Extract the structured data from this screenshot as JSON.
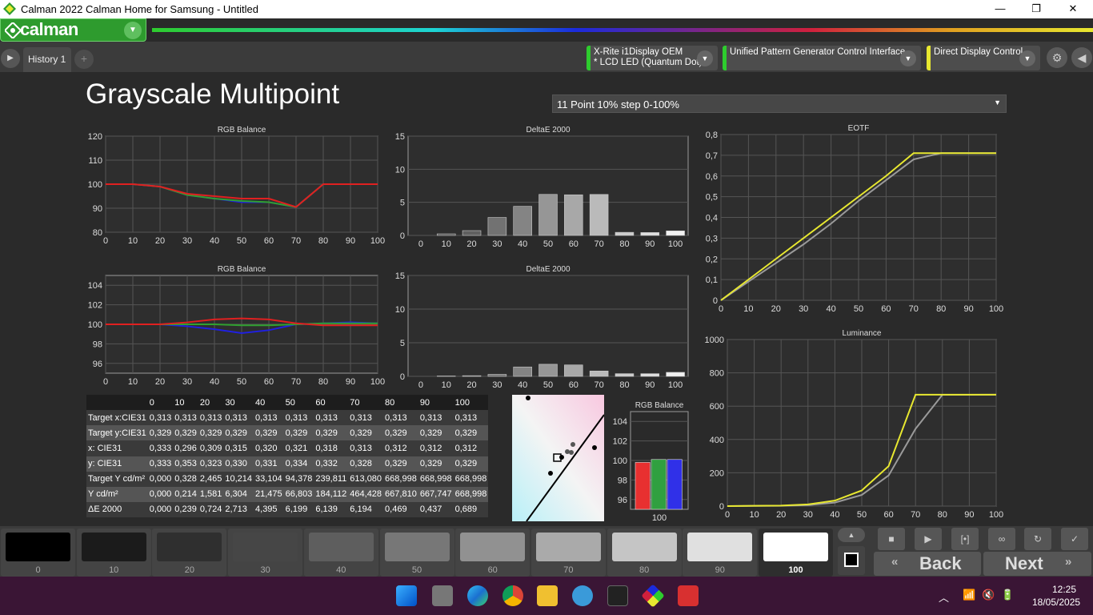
{
  "window": {
    "title": "Calman 2022 Calman Home for Samsung  - Untitled",
    "min": "—",
    "restore": "❐",
    "close": "✕"
  },
  "app": {
    "logo": "calman",
    "tab": "History 1",
    "tab_add": "+"
  },
  "devices": [
    {
      "line1": "X-Rite i1Display OEM",
      "line2": "* LCD LED (Quantum Dot)",
      "color": "#2ecc2e"
    },
    {
      "line1": "Unified Pattern Generator Control Interface",
      "line2": "",
      "color": "#2ecc2e"
    },
    {
      "line1": "Direct Display Control",
      "line2": "",
      "color": "#e8e830"
    }
  ],
  "page": {
    "title": "Grayscale Multipoint",
    "preset": "11 Point 10% step 0-100%"
  },
  "charts": {
    "rgb1": {
      "title": "RGB Balance"
    },
    "de1": {
      "title": "DeltaE 2000"
    },
    "rgb2": {
      "title": "RGB Balance"
    },
    "de2": {
      "title": "DeltaE 2000"
    },
    "eotf": {
      "title": "EOTF"
    },
    "lum": {
      "title": "Luminance"
    },
    "rgbbar": {
      "title": "RGB Balance"
    }
  },
  "chart_data": [
    {
      "type": "line",
      "title": "RGB Balance",
      "x": [
        0,
        10,
        20,
        30,
        40,
        50,
        60,
        70,
        80,
        90,
        100
      ],
      "ylim": [
        80,
        120
      ],
      "yticks": [
        80,
        90,
        100,
        110,
        120
      ],
      "series": [
        {
          "color": "#e02020",
          "values": [
            100,
            100,
            99,
            96,
            95,
            94,
            94,
            90.5,
            100,
            100,
            100
          ]
        },
        {
          "color": "#30a030",
          "values": [
            100,
            100,
            99,
            95.5,
            94,
            93,
            92.5,
            90.5,
            100,
            100,
            100
          ]
        },
        {
          "color": "#2020e0",
          "values": [
            100,
            100,
            99,
            95.5,
            94,
            92.5,
            92.5,
            90.5,
            100,
            100,
            100
          ]
        }
      ]
    },
    {
      "type": "bar",
      "title": "DeltaE 2000",
      "categories": [
        "0",
        "10",
        "20",
        "30",
        "40",
        "50",
        "60",
        "70",
        "80",
        "90",
        "100"
      ],
      "values": [
        0.0,
        0.239,
        0.724,
        2.713,
        4.395,
        6.199,
        6.139,
        6.194,
        0.469,
        0.437,
        0.689
      ],
      "ylim": [
        0,
        15
      ],
      "yticks": [
        0,
        5,
        10,
        15
      ]
    },
    {
      "type": "line",
      "title": "RGB Balance",
      "x": [
        0,
        10,
        20,
        30,
        40,
        50,
        60,
        70,
        80,
        90,
        100
      ],
      "ylim": [
        95,
        105
      ],
      "yticks": [
        96,
        98,
        100,
        102,
        104
      ],
      "series": [
        {
          "color": "#e02020",
          "values": [
            100,
            100,
            100,
            100.2,
            100.5,
            100.6,
            100.5,
            100.1,
            99.9,
            99.9,
            99.9
          ]
        },
        {
          "color": "#30a030",
          "values": [
            100,
            100,
            100,
            100,
            100,
            99.9,
            99.9,
            100,
            100.1,
            100.1,
            100.1
          ]
        },
        {
          "color": "#2020e0",
          "values": [
            100,
            100,
            100,
            99.8,
            99.5,
            99.1,
            99.4,
            100,
            100.1,
            100.2,
            100.1
          ]
        }
      ]
    },
    {
      "type": "bar",
      "title": "DeltaE 2000",
      "categories": [
        "0",
        "10",
        "20",
        "30",
        "40",
        "50",
        "60",
        "70",
        "80",
        "90",
        "100"
      ],
      "values": [
        0.0,
        0.05,
        0.1,
        0.3,
        1.4,
        1.8,
        1.7,
        0.8,
        0.4,
        0.4,
        0.6
      ],
      "ylim": [
        0,
        15
      ],
      "yticks": [
        0,
        5,
        10,
        15
      ]
    },
    {
      "type": "line",
      "title": "EOTF",
      "x": [
        0,
        10,
        20,
        30,
        40,
        50,
        60,
        70,
        80,
        90,
        100
      ],
      "ylim": [
        0,
        0.8
      ],
      "yticks": [
        "0",
        "0,1",
        "0,2",
        "0,3",
        "0,4",
        "0,5",
        "0,6",
        "0,7",
        "0,8"
      ],
      "series": [
        {
          "color": "#e8e830",
          "values": [
            0,
            0.1,
            0.2,
            0.3,
            0.4,
            0.5,
            0.6,
            0.71,
            0.71,
            0.71,
            0.71
          ]
        },
        {
          "color": "#9a9a9a",
          "values": [
            0,
            0.09,
            0.18,
            0.27,
            0.37,
            0.48,
            0.58,
            0.68,
            0.71,
            0.71,
            0.71
          ]
        }
      ]
    },
    {
      "type": "line",
      "title": "Luminance",
      "x": [
        0,
        10,
        20,
        30,
        40,
        50,
        60,
        70,
        80,
        90,
        100
      ],
      "ylim": [
        0,
        1000
      ],
      "yticks": [
        0,
        200,
        400,
        600,
        800,
        1000
      ],
      "series": [
        {
          "color": "#e8e830",
          "values": [
            0,
            2,
            3,
            10,
            33,
            94,
            240,
            669,
            669,
            669,
            669
          ]
        },
        {
          "color": "#9a9a9a",
          "values": [
            0,
            1,
            2,
            6,
            21,
            67,
            184,
            464,
            668,
            668,
            669
          ]
        }
      ]
    },
    {
      "type": "bar",
      "title": "RGB Balance",
      "categories": [
        "100"
      ],
      "ylim": [
        95,
        105
      ],
      "yticks": [
        96,
        98,
        100,
        102,
        104
      ],
      "series": [
        {
          "color": "#e83030",
          "values": [
            99.8
          ]
        },
        {
          "color": "#30a040",
          "values": [
            100.1
          ]
        },
        {
          "color": "#3030e8",
          "values": [
            100.1
          ]
        }
      ]
    }
  ],
  "table": {
    "header": [
      "",
      "0",
      "10",
      "20",
      "30",
      "40",
      "50",
      "60",
      "70",
      "80",
      "90",
      "100"
    ],
    "rows": [
      [
        "Target x:CIE31",
        "0,313",
        "0,313",
        "0,313",
        "0,313",
        "0,313",
        "0,313",
        "0,313",
        "0,313",
        "0,313",
        "0,313",
        "0,313"
      ],
      [
        "Target y:CIE31",
        "0,329",
        "0,329",
        "0,329",
        "0,329",
        "0,329",
        "0,329",
        "0,329",
        "0,329",
        "0,329",
        "0,329",
        "0,329"
      ],
      [
        "x: CIE31",
        "0,333",
        "0,296",
        "0,309",
        "0,315",
        "0,320",
        "0,321",
        "0,318",
        "0,313",
        "0,312",
        "0,312",
        "0,312"
      ],
      [
        "y: CIE31",
        "0,333",
        "0,353",
        "0,323",
        "0,330",
        "0,331",
        "0,334",
        "0,332",
        "0,328",
        "0,329",
        "0,329",
        "0,329"
      ],
      [
        "Target Y cd/m²",
        "0,000",
        "0,328",
        "2,465",
        "10,214",
        "33,104",
        "94,378",
        "239,811",
        "613,080",
        "668,998",
        "668,998",
        "668,998"
      ],
      [
        "Y cd/m²",
        "0,000",
        "0,214",
        "1,581",
        "6,304",
        "21,475",
        "66,803",
        "184,112",
        "464,428",
        "667,810",
        "667,747",
        "668,998"
      ],
      [
        "ΔE 2000",
        "0,000",
        "0,239",
        "0,724",
        "2,713",
        "4,395",
        "6,199",
        "6,139",
        "6,194",
        "0,469",
        "0,437",
        "0,689"
      ]
    ]
  },
  "swatches": [
    {
      "label": "0",
      "color": "#000000"
    },
    {
      "label": "10",
      "color": "#1b1b1b"
    },
    {
      "label": "20",
      "color": "#2f2f2f"
    },
    {
      "label": "30",
      "color": "#464646"
    },
    {
      "label": "40",
      "color": "#5e5e5e"
    },
    {
      "label": "50",
      "color": "#777777"
    },
    {
      "label": "60",
      "color": "#919191"
    },
    {
      "label": "70",
      "color": "#aaaaaa"
    },
    {
      "label": "80",
      "color": "#c5c5c5"
    },
    {
      "label": "90",
      "color": "#e0e0e0"
    },
    {
      "label": "100",
      "color": "#ffffff"
    }
  ],
  "nav": {
    "back": "Back",
    "next": "Next"
  },
  "tray": {
    "time": "12:25",
    "date": "18/05/2025"
  }
}
